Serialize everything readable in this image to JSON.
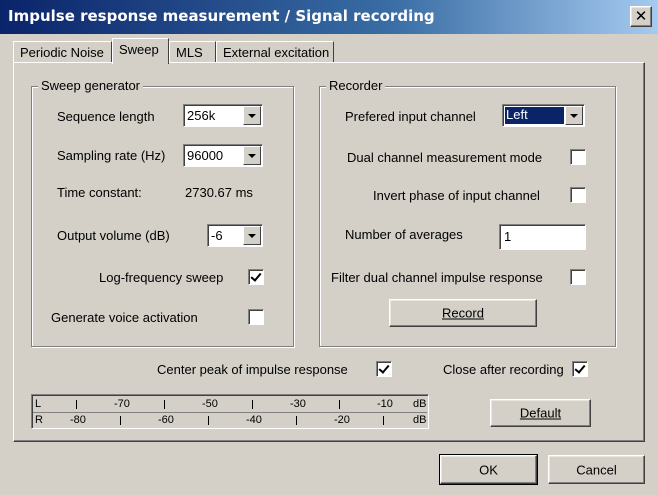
{
  "window": {
    "title": "Impulse response measurement / Signal recording",
    "close_glyph": "✕"
  },
  "tabs": [
    {
      "label": "Periodic Noise",
      "active": false
    },
    {
      "label": "Sweep",
      "active": true
    },
    {
      "label": "MLS",
      "active": false
    },
    {
      "label": "External excitation",
      "active": false
    }
  ],
  "sweep_generator": {
    "title": "Sweep generator",
    "sequence_length_label": "Sequence length",
    "sequence_length_value": "256k",
    "sampling_rate_label": "Sampling rate (Hz)",
    "sampling_rate_value": "96000",
    "time_constant_label": "Time constant:",
    "time_constant_value": "2730.67 ms",
    "output_volume_label": "Output volume (dB)",
    "output_volume_value": "-6",
    "log_sweep_label": "Log-frequency sweep",
    "log_sweep_checked": true,
    "voice_activation_label": "Generate voice activation",
    "voice_activation_checked": false
  },
  "recorder": {
    "title": "Recorder",
    "input_channel_label": "Prefered input channel",
    "input_channel_value": "Left",
    "dual_channel_label": "Dual channel measurement mode",
    "dual_channel_checked": false,
    "invert_phase_label": "Invert phase of input channel",
    "invert_phase_checked": false,
    "averages_label": "Number of averages",
    "averages_value": "1",
    "filter_dual_label": "Filter dual channel impulse response",
    "filter_dual_checked": false,
    "record_button": "Record"
  },
  "options": {
    "center_peak_label": "Center peak of impulse response",
    "center_peak_checked": true,
    "close_after_label": "Close after recording",
    "close_after_checked": true
  },
  "meter": {
    "left_channel": "L",
    "right_channel": "R",
    "unit": "dB",
    "left_scale": [
      "-70",
      "-50",
      "-30",
      "-10"
    ],
    "right_scale": [
      "-80",
      "-60",
      "-40",
      "-20"
    ]
  },
  "buttons": {
    "default": "Default",
    "ok": "OK",
    "cancel": "Cancel"
  }
}
